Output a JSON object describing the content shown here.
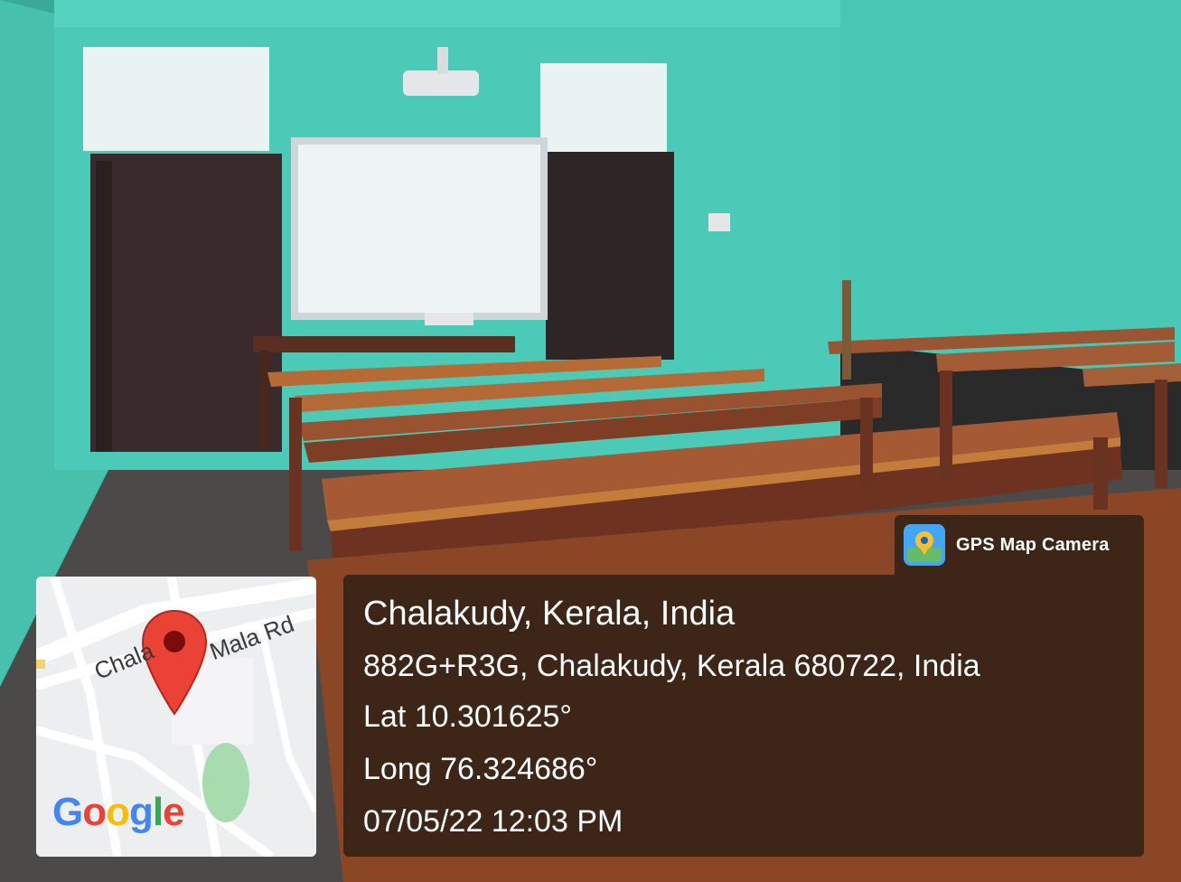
{
  "badge": {
    "label": "GPS Map Camera",
    "icon": "gps-map-camera-icon"
  },
  "location": {
    "place": "Chalakudy, Kerala, India",
    "address": "882G+R3G, Chalakudy, Kerala 680722, India",
    "lat": "Lat 10.301625°",
    "long": "Long 76.324686°",
    "datetime": "07/05/22 12:03 PM"
  },
  "map": {
    "road_1": "Chala",
    "road_2": "Mala Rd",
    "logo_letters": [
      "G",
      "o",
      "o",
      "g",
      "l",
      "e"
    ],
    "pin_color": "#EA4335"
  },
  "colors": {
    "wall": "#3ec9b6",
    "door": "#3b2a2a",
    "desk": "#8a4a2a",
    "overlay": "#281c14"
  }
}
